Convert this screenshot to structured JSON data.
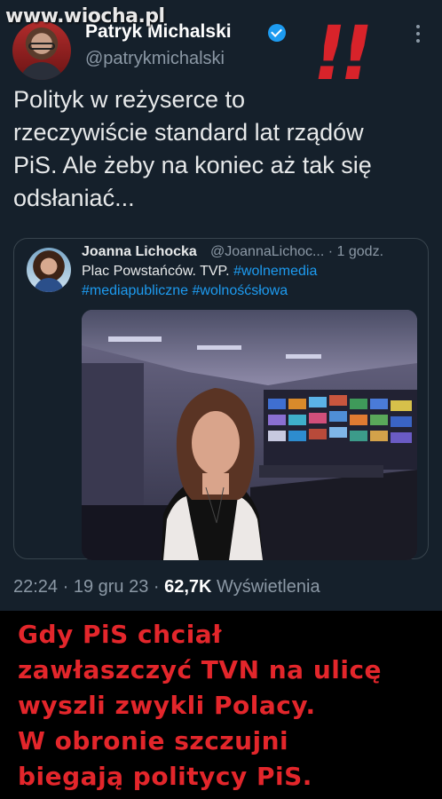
{
  "watermark": "www.wiocha.pl",
  "tweet": {
    "author_name": "Patryk Michalski",
    "author_handle": "@patrykmichalski",
    "emphasis": "!!",
    "text_lines": [
      "Polityk w reżyserce to",
      "rzeczywiście standard lat rządów",
      "PiS. Ale żeby na koniec aż tak się",
      "odsłaniać..."
    ],
    "quoted": {
      "author_name": "Joanna Lichocka",
      "author_handle_time": "@JoannaLichoc... · 1 godz.",
      "text": "Plac Powstańców. TVP. ",
      "tags_line1": "#wolnemedia",
      "tags_line2": "#mediapubliczne #wolnośćsłowa"
    },
    "time": "22:24 · 19 gru 23 · ",
    "views_count": "62,7K",
    "views_label": " Wyświetlenia"
  },
  "caption_lines": [
    "Gdy PiS chciał",
    "zawłaszczyć TVN na ulicę",
    "wyszli zwykli Polacy.",
    "W obronie szczujni",
    "biegają politycy PiS."
  ],
  "colors": {
    "background": "#15202b",
    "accent": "#1d9bf0",
    "caption_red": "#e3262b"
  },
  "icons": [
    "verified-badge-icon",
    "more-options-icon"
  ]
}
